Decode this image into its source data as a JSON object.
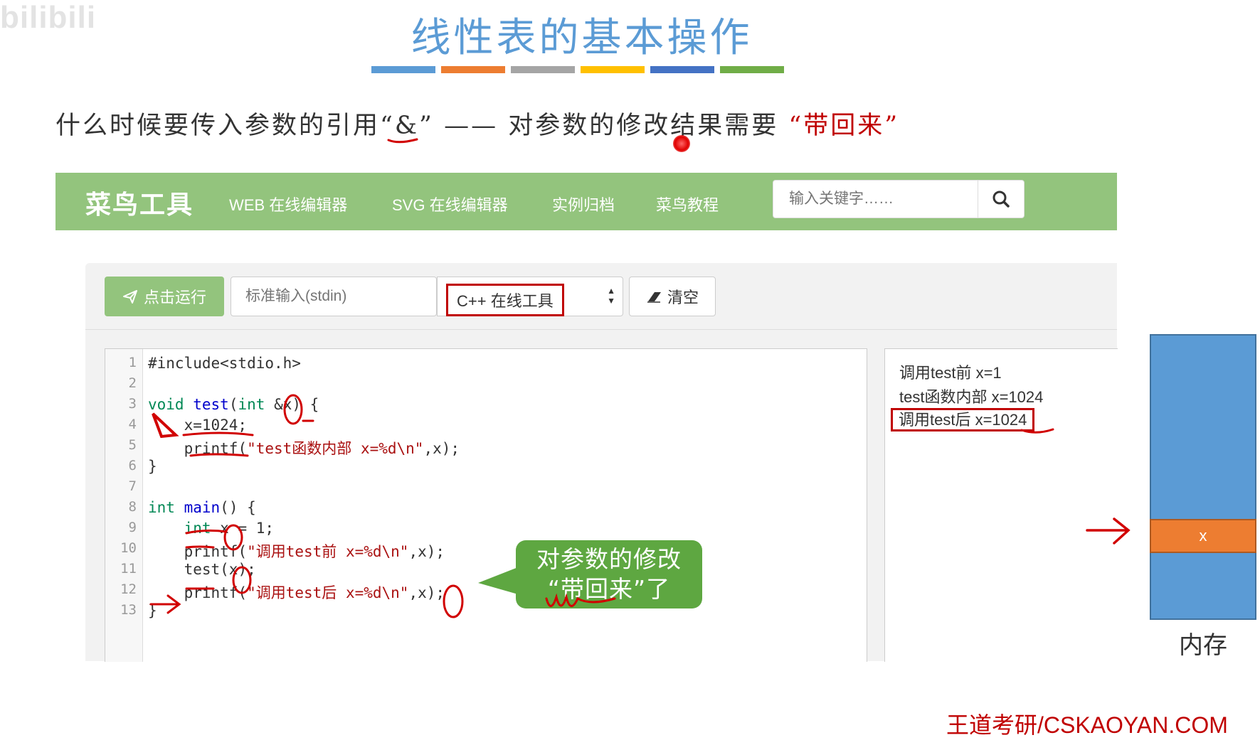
{
  "watermark": "bilibili",
  "slide": {
    "title": "线性表的基本操作",
    "bar_colors": [
      "#5b9bd5",
      "#ed7d31",
      "#a5a5a5",
      "#ffc000",
      "#4472c4",
      "#70ad47"
    ],
    "subtitle_left": "什么时候要传入参数的引用“&” —— 对参数的修改结果需要",
    "subtitle_red": "“带回来”"
  },
  "navbar": {
    "brand": "菜鸟工具",
    "links": [
      "WEB 在线编辑器",
      "SVG 在线编辑器",
      "实例归档",
      "菜鸟教程"
    ],
    "search_placeholder": "输入关键字……",
    "search_icon": "search-icon"
  },
  "toolbar": {
    "run_label": "点击运行",
    "run_icon": "paper-plane-icon",
    "stdin_placeholder": "标准输入(stdin)",
    "language": "C++ 在线工具",
    "clear_label": "清空",
    "clear_icon": "eraser-icon"
  },
  "code": {
    "lines": [
      {
        "n": "1"
      },
      {
        "n": "2"
      },
      {
        "n": "3"
      },
      {
        "n": "4"
      },
      {
        "n": "5"
      },
      {
        "n": "6"
      },
      {
        "n": "7"
      },
      {
        "n": "8"
      },
      {
        "n": "9"
      },
      {
        "n": "10"
      },
      {
        "n": "11"
      },
      {
        "n": "12"
      },
      {
        "n": "13"
      }
    ],
    "tokens": {
      "l1": "#include<stdio.h>",
      "void": "void",
      "test": "test",
      "int": "int",
      "amp": "&",
      "l3_rest": "x) {",
      "l4": "x=1024;",
      "printf": "printf",
      "l5_str": "\"test函数内部 x=%d\\n\"",
      "l5_rest": ",x);",
      "close": "}",
      "main": "main",
      "l8_rest": "() {",
      "l9_rest": "x = 1;",
      "l10_str": "\"调用test前 x=%d\\n\"",
      "l10_rest": ",x);",
      "l11_rest": "(x);",
      "l12_str": "\"调用test后 x=%d\\n\"",
      "l12_rest": ",x);"
    }
  },
  "output": {
    "lines": [
      "调用test前 x=1",
      "test函数内部 x=1024",
      "调用test后 x=1024"
    ]
  },
  "bubble": {
    "line1": "对参数的修改",
    "line2": "“带回来”了"
  },
  "memory": {
    "cell_label": "x",
    "caption": "内存",
    "colors": {
      "block": "#5b9bd5",
      "cell": "#ed7d31"
    }
  },
  "footer": "王道考研/CSKAOYAN.COM",
  "colors": {
    "accent_green": "#93c47d",
    "highlight_red": "#c00000",
    "title_blue": "#5b9bd5"
  }
}
